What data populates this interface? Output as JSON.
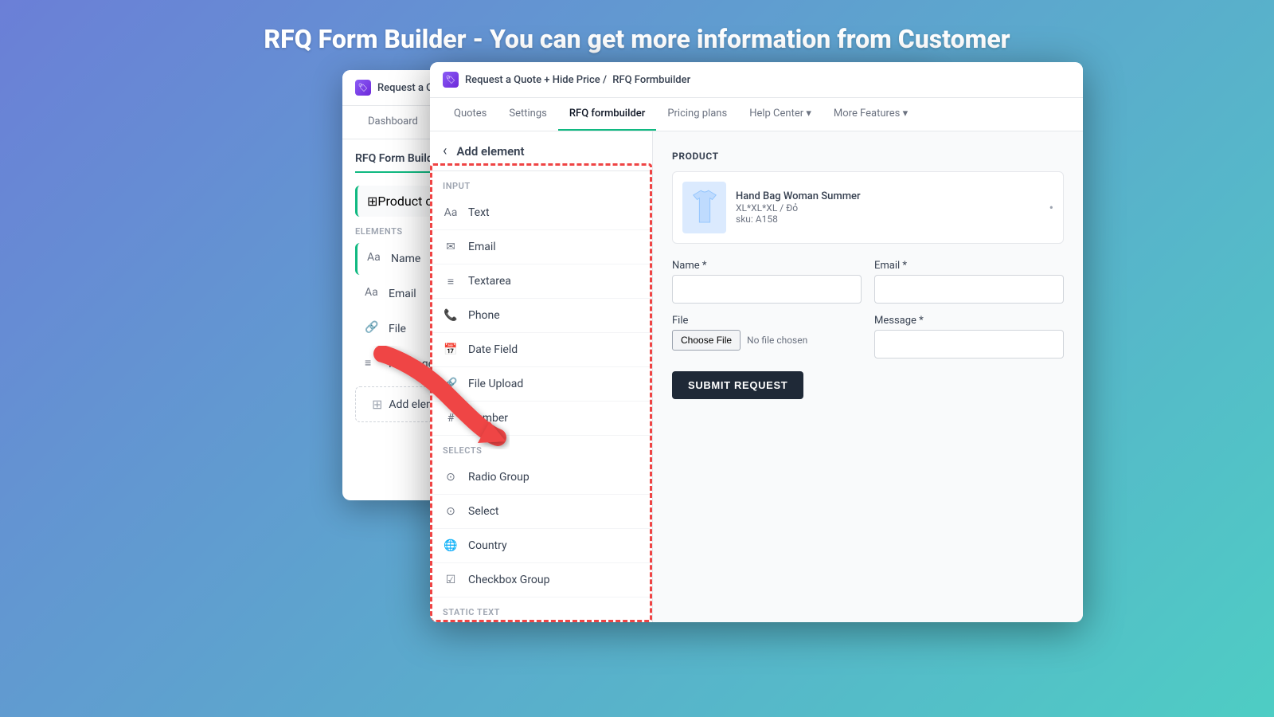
{
  "page": {
    "title": "RFQ Form Builder - You can get more information from Customer"
  },
  "left_screenshot": {
    "app_bar": {
      "breadcrumb_pre": "Request a Quote + Hide Price /",
      "breadcrumb_current": "RFQ Formbuilder"
    },
    "nav": {
      "tabs": [
        "Dashboard",
        "Quotes",
        "Settings",
        "RFQ formbuilder",
        "Pricing plans",
        "Help Center ▾",
        "More Featu..."
      ]
    },
    "sidebar": {
      "title": "RFQ Form Builder",
      "product_columns_label": "Product column(s)",
      "elements_section": "ELEMENTS",
      "elements": [
        {
          "label": "Name",
          "icon": "text-icon"
        },
        {
          "label": "Email",
          "icon": "text-icon"
        },
        {
          "label": "File",
          "icon": "file-icon"
        },
        {
          "label": "Message",
          "icon": "message-icon"
        }
      ],
      "add_element_label": "Add element"
    },
    "form_preview": {
      "product_section": "PRODUCT",
      "product_name": "Hand Bag Woman Summer",
      "product_variant": "XL*XL*XL / Đỏ",
      "product_sku": "sku: A158",
      "name_label": "Name *",
      "file_label": "File",
      "file_btn": "Choose File",
      "file_no_file": "No file cho...",
      "submit_btn": "SUBMIT REQUEST"
    }
  },
  "right_screenshot": {
    "app_bar": {
      "icon": "🏷",
      "breadcrumb_pre": "Request a Quote + Hide Price /",
      "breadcrumb_current": "RFQ Formbuilder"
    },
    "nav": {
      "tabs": [
        "Quotes",
        "Settings",
        "RFQ formbuilder",
        "Pricing plans",
        "Help Center ▾",
        "More Features ▾"
      ],
      "active_tab": "RFQ formbuilder"
    },
    "add_element_panel": {
      "back_icon": "‹",
      "title": "Add element",
      "input_section": "INPUT",
      "elements_input": [
        {
          "label": "Text",
          "icon": "text-icon"
        },
        {
          "label": "Email",
          "icon": "email-icon"
        },
        {
          "label": "Textarea",
          "icon": "textarea-icon"
        },
        {
          "label": "Phone",
          "icon": "phone-icon"
        },
        {
          "label": "Date Field",
          "icon": "date-icon"
        },
        {
          "label": "File Upload",
          "icon": "file-upload-icon"
        },
        {
          "label": "Number",
          "icon": "number-icon"
        }
      ],
      "selects_section": "SELECTS",
      "elements_selects": [
        {
          "label": "Radio Group",
          "icon": "radio-icon"
        },
        {
          "label": "Select",
          "icon": "select-icon"
        },
        {
          "label": "Country",
          "icon": "country-icon"
        },
        {
          "label": "Checkbox Group",
          "icon": "checkbox-icon"
        }
      ],
      "static_section": "STATIC TEXT"
    },
    "form_area": {
      "product_section": "PRODUCT",
      "product_name": "Hand Bag Woman Summer",
      "product_variant": "XL*XL*XL / Đỏ",
      "product_sku": "sku: A158",
      "name_label": "Name *",
      "email_label": "Email *",
      "file_label": "File",
      "message_label": "Message *",
      "file_btn": "Choose File",
      "file_no_file": "No file chosen",
      "submit_btn": "SUBMIT REQUEST"
    }
  },
  "colors": {
    "accent": "#10b981",
    "dark_btn": "#1f2937",
    "dashed_border": "#ef4444",
    "background_gradient_start": "#6b7fd7",
    "background_gradient_end": "#4ecdc4"
  }
}
